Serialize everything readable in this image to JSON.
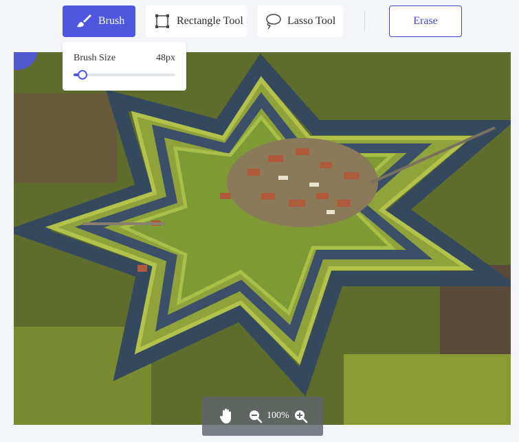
{
  "toolbar": {
    "brush_label": "Brush",
    "rectangle_label": "Rectangle Tool",
    "lasso_label": "Lasso Tool",
    "erase_label": "Erase",
    "active_tool": "brush"
  },
  "brush_settings": {
    "size_label": "Brush Size",
    "size_value": "48px",
    "size_fraction": 0.09
  },
  "zoom": {
    "level": "100%"
  },
  "colors": {
    "accent": "#4f57e0",
    "erase_border": "#3e46d6"
  },
  "icons": {
    "brush": "paintbrush-icon",
    "rectangle": "rectangle-select-icon",
    "lasso": "lasso-icon",
    "pan": "hand-icon",
    "zoom_out": "zoom-out-icon",
    "zoom_in": "zoom-in-icon"
  }
}
